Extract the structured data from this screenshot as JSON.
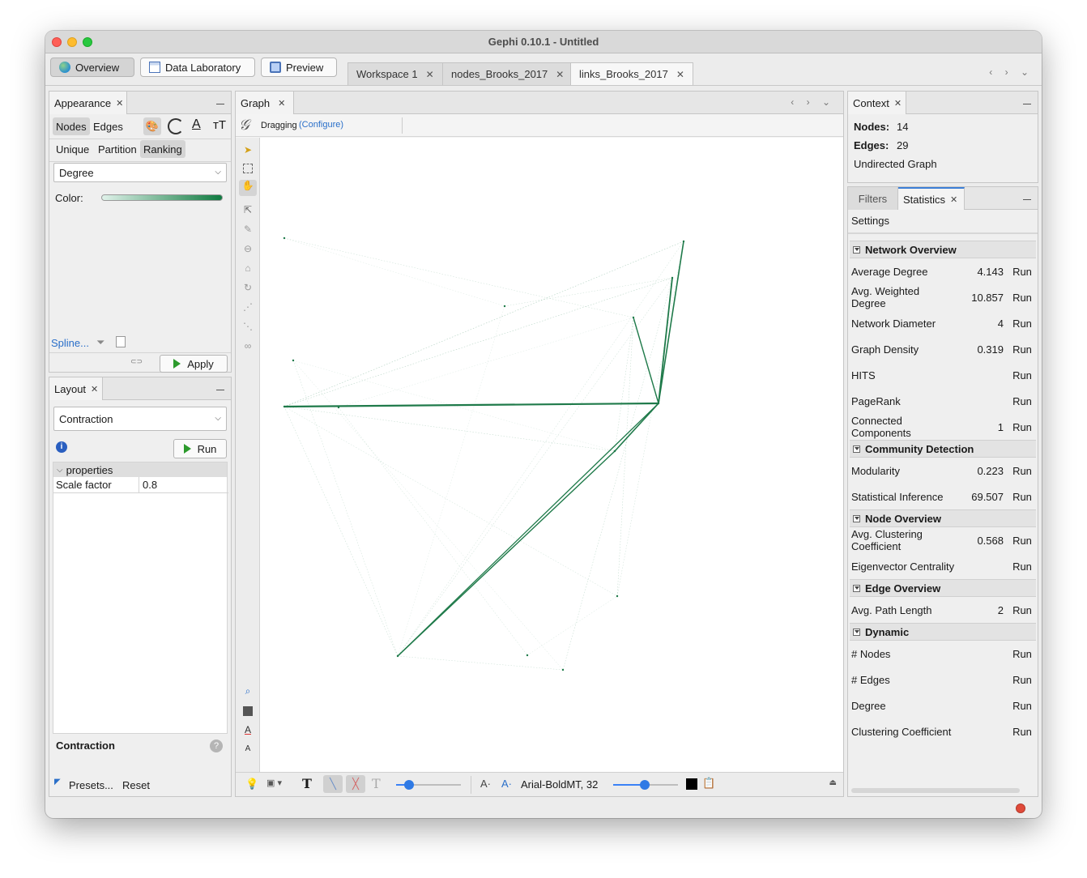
{
  "window": {
    "title": "Gephi 0.10.1 - Untitled"
  },
  "modes": {
    "overview": "Overview",
    "data_lab": "Data Laboratory",
    "preview": "Preview"
  },
  "workspace_tabs": [
    "Workspace 1",
    "nodes_Brooks_2017",
    "links_Brooks_2017"
  ],
  "appearance": {
    "tab": "Appearance",
    "element_tabs": [
      "Nodes",
      "Edges"
    ],
    "modes": [
      "Unique",
      "Partition",
      "Ranking"
    ],
    "attribute": "Degree",
    "color_label": "Color:",
    "spline_link": "Spline...",
    "apply_label": "Apply",
    "gradient": [
      "#e0f2ea",
      "#0e7a3f"
    ]
  },
  "layout": {
    "tab": "Layout",
    "algorithm": "Contraction",
    "run_label": "Run",
    "section": "properties",
    "prop_name": "Scale factor",
    "prop_value": "0.8",
    "description_title": "Contraction",
    "presets": "Presets...",
    "reset": "Reset"
  },
  "graph": {
    "tab": "Graph",
    "mode_label": "Dragging",
    "configure": "(Configure)",
    "font_label": "Arial-BoldMT, 32",
    "edge_color": "#1f7a4a"
  },
  "context": {
    "tab": "Context",
    "nodes_label": "Nodes:",
    "nodes_value": "14",
    "edges_label": "Edges:",
    "edges_value": "29",
    "graph_type": "Undirected Graph"
  },
  "statistics": {
    "tabs": [
      "Filters",
      "Statistics"
    ],
    "settings": "Settings",
    "run": "Run",
    "sections": [
      {
        "title": "Network Overview",
        "rows": [
          {
            "name": "Average Degree",
            "value": "4.143"
          },
          {
            "name": "Avg. Weighted Degree",
            "value": "10.857"
          },
          {
            "name": "Network Diameter",
            "value": "4"
          },
          {
            "name": "Graph Density",
            "value": "0.319"
          },
          {
            "name": "HITS",
            "value": ""
          },
          {
            "name": "PageRank",
            "value": ""
          },
          {
            "name": "Connected Components",
            "value": "1"
          }
        ]
      },
      {
        "title": "Community Detection",
        "rows": [
          {
            "name": "Modularity",
            "value": "0.223"
          },
          {
            "name": "Statistical Inference",
            "value": "69.507"
          }
        ]
      },
      {
        "title": "Node Overview",
        "rows": [
          {
            "name": "Avg. Clustering Coefficient",
            "value": "0.568"
          },
          {
            "name": "Eigenvector Centrality",
            "value": ""
          }
        ]
      },
      {
        "title": "Edge Overview",
        "rows": [
          {
            "name": "Avg. Path Length",
            "value": "2"
          }
        ]
      },
      {
        "title": "Dynamic",
        "rows": [
          {
            "name": "# Nodes",
            "value": ""
          },
          {
            "name": "# Edges",
            "value": ""
          },
          {
            "name": "Degree",
            "value": ""
          },
          {
            "name": "Clustering Coefficient",
            "value": ""
          }
        ]
      }
    ]
  }
}
